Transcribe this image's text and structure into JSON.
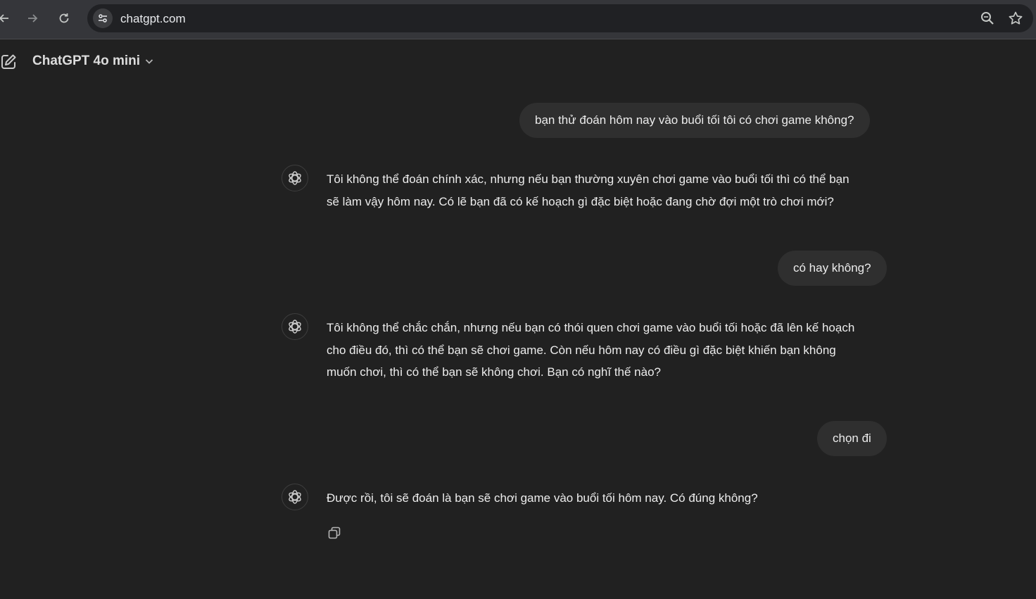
{
  "browser": {
    "url": "chatgpt.com"
  },
  "header": {
    "model_name": "ChatGPT 4o mini"
  },
  "messages": [
    {
      "role": "user",
      "text": "bạn thử đoán hôm nay vào buổi tối tôi có chơi game không?"
    },
    {
      "role": "assistant",
      "lines": [
        "Tôi không thể đoán chính xác, nhưng nếu bạn thường xuyên chơi game vào buổi tối thì có thể bạn",
        "sẽ làm vậy hôm nay. Có lẽ bạn đã có kế hoạch gì đặc biệt hoặc đang chờ đợi một trò chơi mới?"
      ]
    },
    {
      "role": "user",
      "text": "có hay không?"
    },
    {
      "role": "assistant",
      "lines": [
        "Tôi không thể chắc chắn, nhưng nếu bạn có thói quen chơi game vào buổi tối hoặc đã lên kế hoạch",
        "cho điều đó, thì có thể bạn sẽ chơi game. Còn nếu hôm nay có điều gì đặc biệt khiến bạn không",
        "muốn chơi, thì có thể bạn sẽ không chơi. Bạn có nghĩ thế nào?"
      ]
    },
    {
      "role": "user",
      "text": "chọn đi"
    },
    {
      "role": "assistant",
      "lines": [
        "Được rồi, tôi sẽ đoán là bạn sẽ chơi game vào buổi tối hôm nay. Có đúng không?"
      ]
    }
  ],
  "colors": {
    "background": "#212121",
    "user_bubble": "#2f2f2f",
    "text": "#ececec"
  }
}
